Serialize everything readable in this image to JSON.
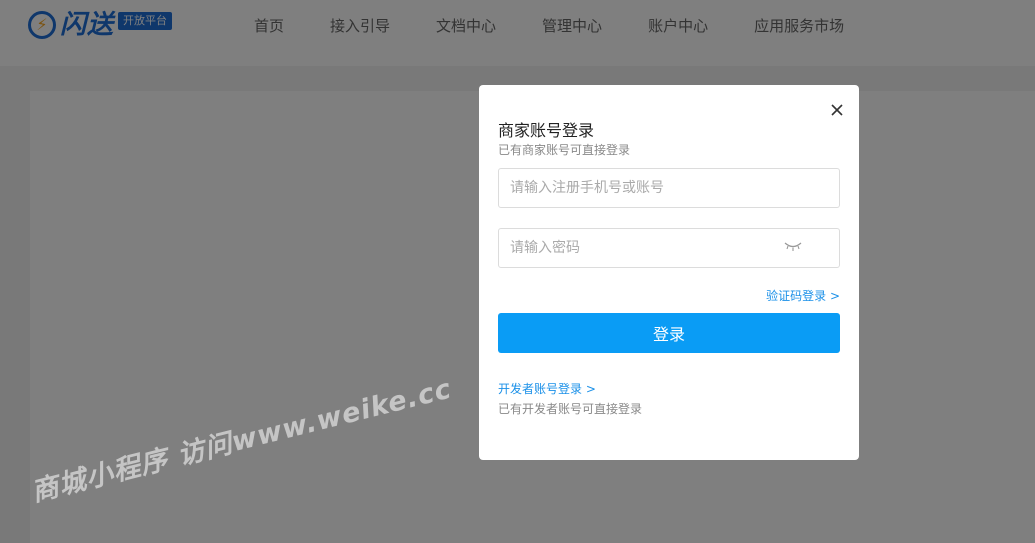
{
  "header": {
    "logo_mark": "⚡",
    "logo_text": "闪送",
    "logo_badge": "开放平台",
    "nav": [
      {
        "label": "首页"
      },
      {
        "label": "接入引导"
      },
      {
        "label": "文档中心"
      },
      {
        "label": "管理中心"
      },
      {
        "label": "账户中心"
      },
      {
        "label": "应用服务市场"
      }
    ]
  },
  "modal": {
    "title": "商家账号登录",
    "subtitle": "已有商家账号可直接登录",
    "account_placeholder": "请输入注册手机号或账号",
    "password_placeholder": "请输入密码",
    "sms_login_link": "验证码登录 >",
    "login_button": "登录",
    "developer_link": "开发者账号登录 >",
    "developer_desc": "已有开发者账号可直接登录"
  },
  "watermark": "商城小程序 访问www.weike.cc",
  "colors": {
    "brand": "#1f6fd6",
    "primary_button": "#0a9cf5",
    "link": "#1a90e8",
    "overlay": "rgba(0,0,0,0.5)"
  },
  "icons": [
    "close-icon",
    "eye-closed-icon",
    "lightning-logo-icon"
  ]
}
